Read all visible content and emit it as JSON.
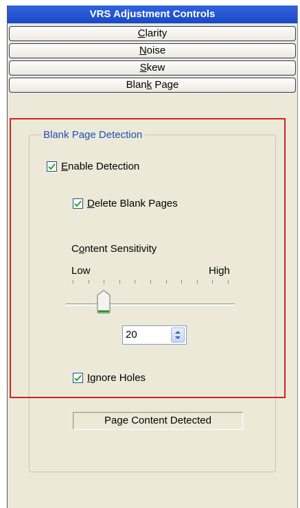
{
  "panel": {
    "title": "VRS Adjustment Controls",
    "tabs": [
      {
        "pre": "",
        "mn": "C",
        "post": "larity"
      },
      {
        "pre": "",
        "mn": "N",
        "post": "oise"
      },
      {
        "pre": "",
        "mn": "S",
        "post": "kew"
      },
      {
        "pre": "Blan",
        "mn": "k",
        "post": " Page"
      }
    ]
  },
  "group": {
    "legend": "Blank Page Detection",
    "enable_detection": {
      "pre": "",
      "mn": "E",
      "post": "nable Detection",
      "checked": true
    },
    "delete_blank_pages": {
      "pre": "",
      "mn": "D",
      "post": "elete Blank Pages",
      "checked": true
    },
    "sensitivity": {
      "label_pre": "C",
      "label_mn": "o",
      "label_post": "ntent Sensitivity",
      "low_label": "Low",
      "high_label": "High",
      "value": 20,
      "min": 0,
      "max": 100
    },
    "ignore_holes": {
      "pre": "",
      "mn": "I",
      "post": "gnore Holes",
      "checked": true
    },
    "status": "Page Content Detected"
  },
  "colors": {
    "title_bar": "#1c4fd4",
    "legend_text": "#1f4fb6",
    "highlight_border": "#d42020",
    "check_mark": "#21a121",
    "thumb_accent": "#21a121"
  }
}
